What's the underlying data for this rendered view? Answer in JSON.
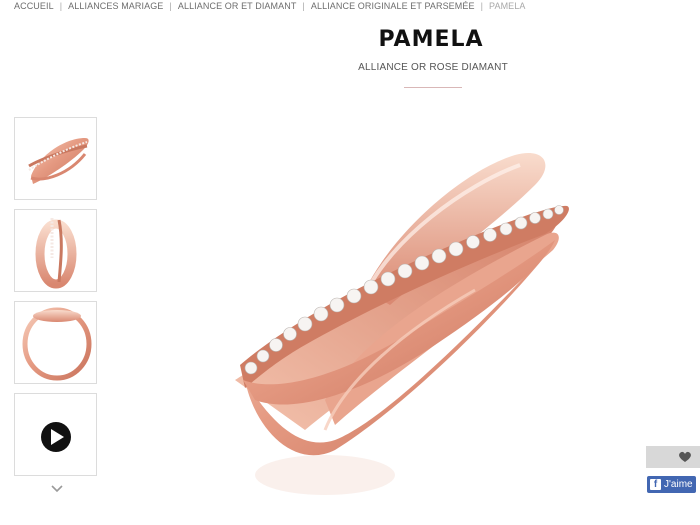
{
  "breadcrumb": {
    "items": [
      "ACCUEIL",
      "ALLIANCES MARIAGE",
      "ALLIANCE OR ET DIAMANT",
      "ALLIANCE ORIGINALE ET PARSEMÉE"
    ],
    "current": "PAMELA",
    "separator": "|"
  },
  "product": {
    "name": "PAMELA",
    "subtitle": "ALLIANCE OR ROSE DIAMANT"
  },
  "gallery": {
    "thumbnails": [
      "ring-side-view",
      "ring-front-view",
      "ring-top-view",
      "video"
    ],
    "scroll_icon": "chevron-down-icon"
  },
  "actions": {
    "wishlist_icon": "heart-icon",
    "facebook_like": "J'aime"
  },
  "colors": {
    "rose_gold": "#e8a08a",
    "facebook": "#4267b2",
    "title": "#111111"
  }
}
